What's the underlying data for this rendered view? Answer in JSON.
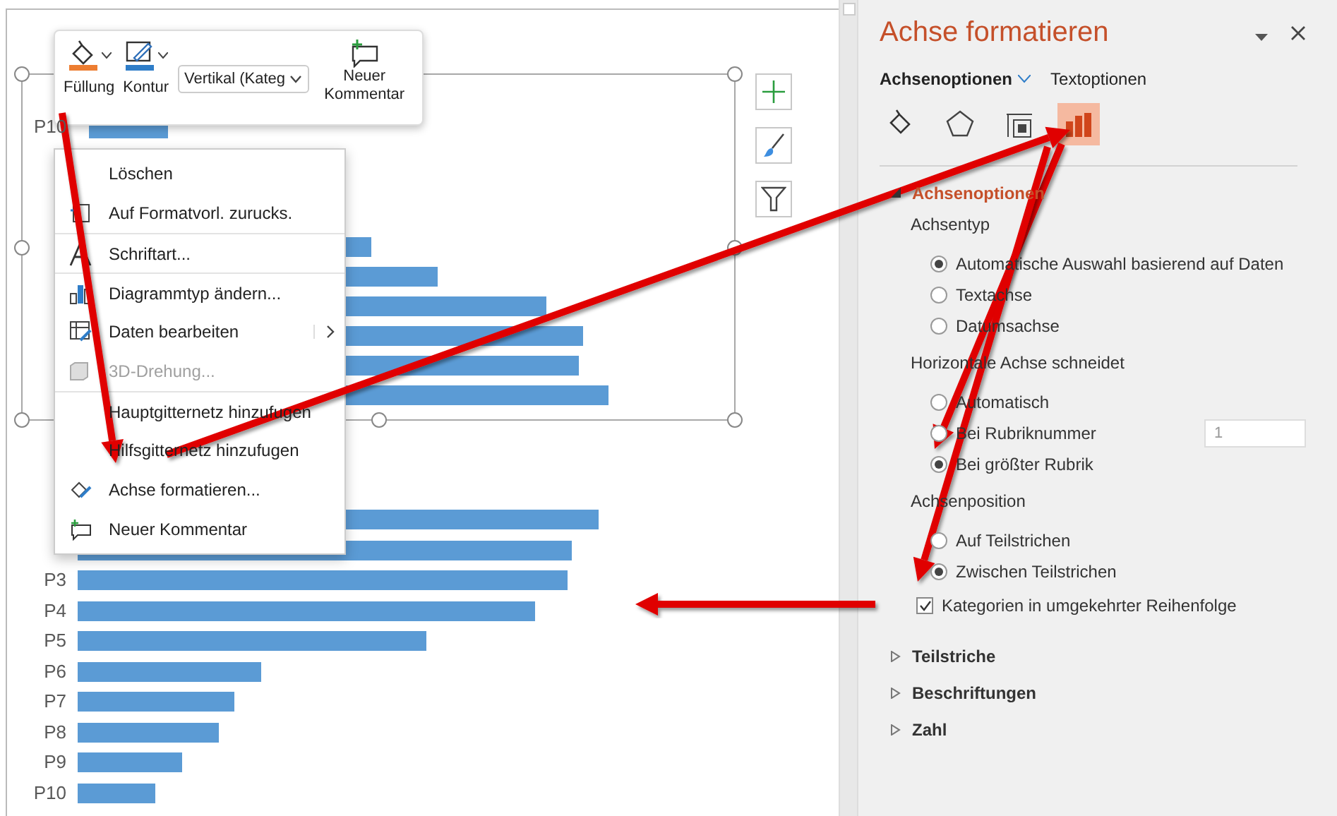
{
  "mini_toolbar": {
    "buttons": [
      {
        "kind": "fill",
        "label": "Füllung"
      },
      {
        "kind": "outline",
        "label": "Kontur"
      }
    ],
    "element_select": {
      "value": "Vertikal (Kateg"
    },
    "comment_button": {
      "label": "Neuer Kommentar"
    }
  },
  "context_menu": [
    {
      "kind": "delete",
      "label": "Löschen",
      "disabled": false,
      "submenu": false,
      "divider_before": false
    },
    {
      "kind": "reset",
      "label": "Auf Formatvorl. zurucks.",
      "disabled": false,
      "submenu": false,
      "divider_before": false
    },
    {
      "kind": "font",
      "label": "Schriftart...",
      "disabled": false,
      "submenu": false,
      "divider_before": true
    },
    {
      "kind": "charttype",
      "label": "Diagrammtyp ändern...",
      "disabled": false,
      "submenu": false,
      "divider_before": true
    },
    {
      "kind": "data",
      "label": "Daten bearbeiten",
      "disabled": false,
      "submenu": true,
      "divider_before": false
    },
    {
      "kind": "rotate",
      "label": "3D-Drehung...",
      "disabled": true,
      "submenu": false,
      "divider_before": false
    },
    {
      "kind": "plain",
      "label": "Hauptgitternetz hinzufugen",
      "disabled": false,
      "submenu": false,
      "divider_before": true
    },
    {
      "kind": "plain",
      "label": "Hilfsgitternetz hinzufugen",
      "disabled": false,
      "submenu": false,
      "divider_before": false
    },
    {
      "kind": "format",
      "label": "Achse formatieren...",
      "disabled": false,
      "submenu": false,
      "divider_before": false
    },
    {
      "kind": "comment",
      "label": "Neuer Kommentar",
      "disabled": false,
      "submenu": false,
      "divider_before": false
    }
  ],
  "top_chart": {
    "visible_label": "P10"
  },
  "chart_tools": [
    {
      "kind": "add"
    },
    {
      "kind": "style"
    },
    {
      "kind": "filter"
    }
  ],
  "bottom_chart": {
    "labels": [
      "P3",
      "P4",
      "P5",
      "P6",
      "P7",
      "P8",
      "P9",
      "P10"
    ]
  },
  "pane": {
    "title": "Achse formatieren",
    "tabs": [
      {
        "label": "Achsenoptionen",
        "selected": true
      },
      {
        "label": "Textoptionen",
        "selected": false
      }
    ],
    "icon_tabs": [
      {
        "kind": "fill",
        "selected": false
      },
      {
        "kind": "effects",
        "selected": false
      },
      {
        "kind": "size",
        "selected": false
      },
      {
        "kind": "axis",
        "selected": true
      }
    ],
    "sections": [
      {
        "label": "Achsenoptionen",
        "expanded": true,
        "groups": [
          {
            "heading": "Achsentyp",
            "options": [
              {
                "label": "Automatische Auswahl basierend auf Daten",
                "selected": true
              },
              {
                "label": "Textachse",
                "selected": false
              },
              {
                "label": "Datumsachse",
                "selected": false
              }
            ]
          },
          {
            "heading": "Horizontale Achse schneidet",
            "options": [
              {
                "label": "Automatisch",
                "selected": false
              },
              {
                "label": "Bei Rubriknummer",
                "selected": false,
                "value": "1"
              },
              {
                "label": "Bei größter Rubrik",
                "selected": true
              }
            ]
          },
          {
            "heading": "Achsenposition",
            "options": [
              {
                "label": "Auf Teilstrichen",
                "selected": false
              },
              {
                "label": "Zwischen Teilstrichen",
                "selected": true
              }
            ]
          }
        ],
        "checkbox": {
          "label": "Kategorien in umgekehrter Reihenfolge",
          "checked": true
        }
      },
      {
        "label": "Teilstriche",
        "expanded": false
      },
      {
        "label": "Beschriftungen",
        "expanded": false
      },
      {
        "label": "Zahl",
        "expanded": false
      }
    ]
  }
}
